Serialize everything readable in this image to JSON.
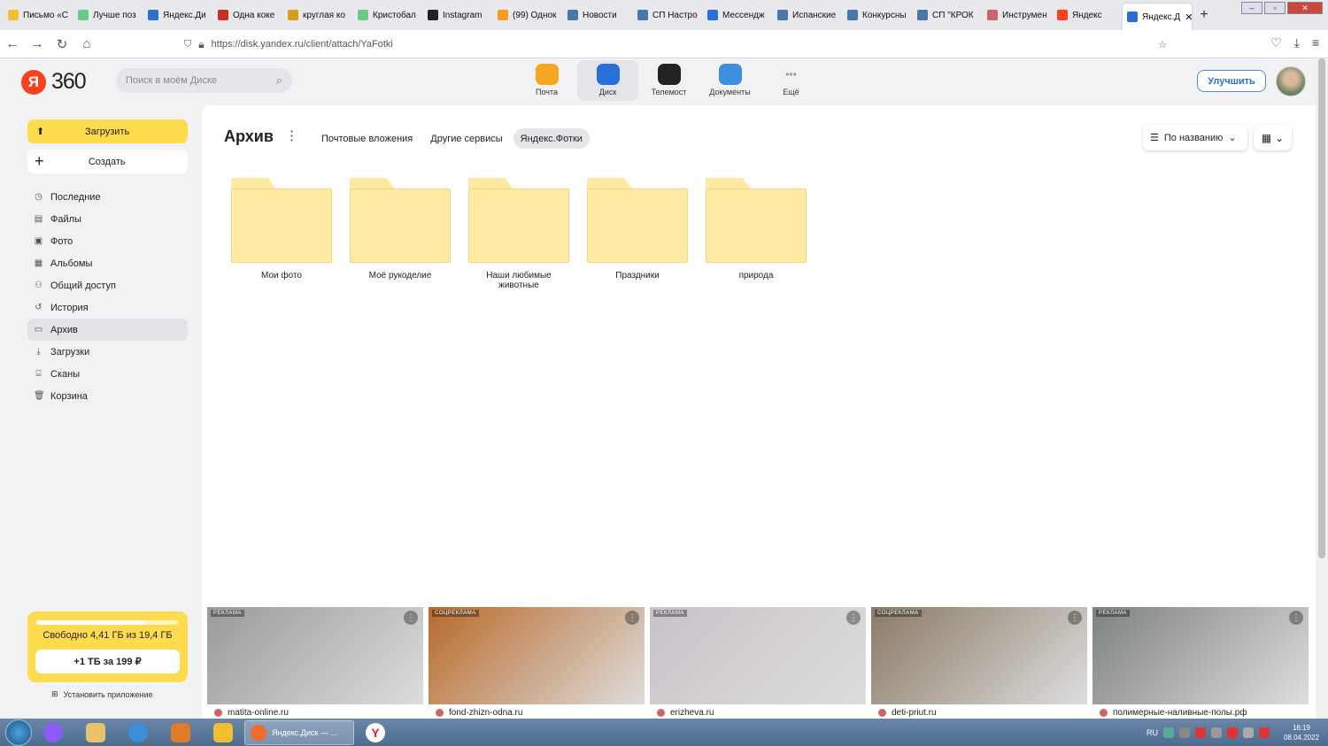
{
  "browser": {
    "tabs": [
      {
        "label": "Письмо «С",
        "color": "#f0c030"
      },
      {
        "label": "Лучше поз",
        "color": "#6c8"
      },
      {
        "label": "Яндекс.Ди",
        "color": "#2a6fd6"
      },
      {
        "label": "Одна коке",
        "color": "#c9302c"
      },
      {
        "label": "круглая ко",
        "color": "#d4a017"
      },
      {
        "label": "Кристобал",
        "color": "#6c8"
      },
      {
        "label": "Instagram",
        "color": "#222"
      },
      {
        "label": "(99) Однок",
        "color": "#f59a23"
      },
      {
        "label": "Новости",
        "color": "#4a76a8"
      },
      {
        "label": "СП Настро",
        "color": "#4a76a8"
      },
      {
        "label": "Мессендж",
        "color": "#2a6fd6"
      },
      {
        "label": "Испанские",
        "color": "#4a76a8"
      },
      {
        "label": "Конкурсны",
        "color": "#4a76a8"
      },
      {
        "label": "СП \"КРОК",
        "color": "#4a76a8"
      },
      {
        "label": "Инструмен",
        "color": "#c66"
      },
      {
        "label": "Яндекс",
        "color": "#fc3f1d"
      }
    ],
    "active_tab": "Яндекс.Д",
    "new_tab": "+",
    "url": "https://disk.yandex.ru/client/attach/YaFotki"
  },
  "header": {
    "logo": "360",
    "logo_letter": "Я",
    "search_placeholder": "Поиск в моём Диске",
    "services": [
      {
        "label": "Почта",
        "color": "#f5a623",
        "icon": "mail-icon"
      },
      {
        "label": "Диск",
        "color": "#2a6fd6",
        "icon": "disk-icon"
      },
      {
        "label": "Телемост",
        "color": "#222",
        "icon": "telemost-icon"
      },
      {
        "label": "Документы",
        "color": "#3d8de0",
        "icon": "docs-icon"
      },
      {
        "label": "Ещё",
        "color": "#aaa",
        "icon": "more-icon"
      }
    ],
    "upgrade": "Улучшить"
  },
  "sidebar": {
    "upload": "Загрузить",
    "create": "Создать",
    "items": [
      {
        "label": "Последние",
        "icon": "◷"
      },
      {
        "label": "Файлы",
        "icon": "▤"
      },
      {
        "label": "Фото",
        "icon": "▣"
      },
      {
        "label": "Альбомы",
        "icon": "▦"
      },
      {
        "label": "Общий доступ",
        "icon": "⚇"
      },
      {
        "label": "История",
        "icon": "↺"
      },
      {
        "label": "Архив",
        "icon": "▭"
      },
      {
        "label": "Загрузки",
        "icon": "⤓"
      },
      {
        "label": "Сканы",
        "icon": "⌸"
      },
      {
        "label": "Корзина",
        "icon": "🗑"
      }
    ],
    "storage_text": "Свободно 4,41 ГБ из 19,4 ГБ",
    "storage_used_fraction": 0.77,
    "buy": "+1 ТБ за 199 ₽",
    "install": "Установить приложение"
  },
  "main": {
    "title": "Архив",
    "filters": [
      "Почтовые вложения",
      "Другие сервисы",
      "Яндекс.Фотки"
    ],
    "sort": "По названию",
    "folders": [
      "Мои фото",
      "Моё рукоделие",
      "Наши любимые животные",
      "Праздники",
      "природа"
    ]
  },
  "ads": [
    {
      "label": "РЕКЛАМА",
      "domain": "matita-online.ru",
      "bg": "#9a9a9a"
    },
    {
      "label": "СОЦРЕКЛАМА",
      "domain": "fond-zhizn-odna.ru",
      "bg": "#b86a2a"
    },
    {
      "label": "РЕКЛАМА",
      "domain": "erizheva.ru",
      "bg": "#c9c2c8"
    },
    {
      "label": "СОЦРЕКЛАМА",
      "domain": "deti-priut.ru",
      "bg": "#8a7a66"
    },
    {
      "label": "РЕКЛАМА",
      "domain": "полимерные-наливные-полы.рф",
      "bg": "#7d8280"
    }
  ],
  "taskbar": {
    "active_label": "Яндекс.Диск — ...",
    "lang": "RU",
    "time": "16:19",
    "date": "08.04.2022"
  }
}
